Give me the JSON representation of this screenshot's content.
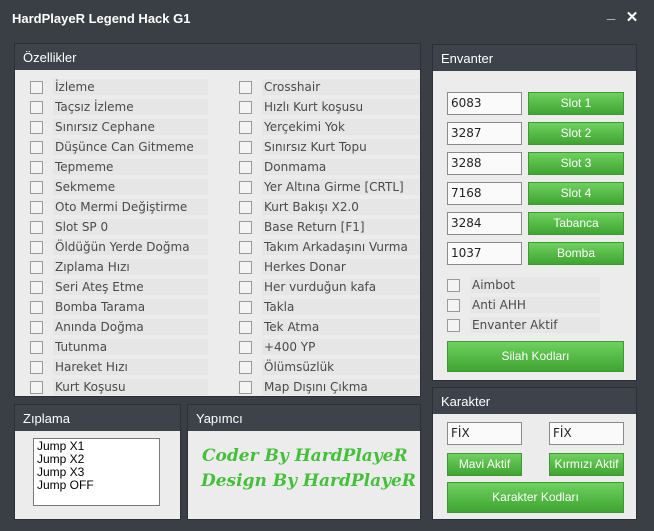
{
  "window": {
    "title": "HardPlayeR Legend Hack G1",
    "minimize_glyph": "_",
    "close_glyph": "✕"
  },
  "features": {
    "title": "Özellikler",
    "left": [
      "İzleme",
      "Taçsız İzleme",
      "Sınırsız Cephane",
      "Düşünce Can Gitmeme",
      "Tepmeme",
      "Sekmeme",
      "Oto Mermi Değiştirme",
      "Slot SP 0",
      "Öldüğün Yerde Doğma",
      "Zıplama Hızı",
      "Seri Ateş Etme",
      "Bomba Tarama",
      "Anında Doğma",
      "Tutunma",
      "Hareket Hızı",
      "Kurt Koşusu"
    ],
    "right": [
      "Crosshair",
      "Hızlı Kurt koşusu",
      "Yerçekimi Yok",
      "Sınırsız Kurt Topu",
      "Donmama",
      "Yer Altına Girme [CRTL]",
      "Kurt Bakışı X2.0",
      "Base Return [F1]",
      "Takım Arkadaşını Vurma",
      "Herkes Donar",
      "Her vurduğun kafa",
      "Takla",
      "Tek Atma",
      "+400 YP",
      "Ölümsüzlük",
      "Map Dışını Çıkma"
    ]
  },
  "inventory": {
    "title": "Envanter",
    "slots": [
      {
        "value": "6083",
        "button": "Slot 1"
      },
      {
        "value": "3287",
        "button": "Slot 2"
      },
      {
        "value": "3288",
        "button": "Slot 3"
      },
      {
        "value": "7168",
        "button": "Slot 4"
      },
      {
        "value": "3284",
        "button": "Tabanca"
      },
      {
        "value": "1037",
        "button": "Bomba"
      }
    ],
    "options": [
      "Aimbot",
      "Anti AHH",
      "Envanter Aktif"
    ],
    "weapon_codes_button": "Silah Kodları"
  },
  "jump": {
    "title": "Zıplama",
    "items": [
      "Jump X1",
      "Jump X2",
      "Jump X3",
      "Jump OFF"
    ]
  },
  "credits": {
    "title": "Yapımcı",
    "line1": "Coder By HardPlayeR",
    "line2": "Design By HardPlayeR"
  },
  "character": {
    "title": "Karakter",
    "field1": "FİX",
    "field2": "FİX",
    "blue_button": "Mavi Aktif",
    "red_button": "Kırmızı Aktif",
    "codes_button": "Karakter Kodları"
  },
  "colors": {
    "accent_green": "#4cb53d",
    "header_dark": "#3d424b",
    "panel_bg": "#ececec",
    "credit_green": "#45c03a"
  }
}
